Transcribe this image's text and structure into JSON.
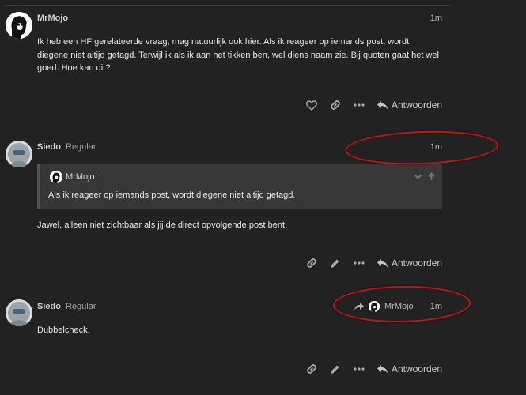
{
  "posts": [
    {
      "username": "MrMojo",
      "user_title": "",
      "time": "1m",
      "text": "Ik heb een HF gerelateerde vraag, mag natuurlijk ook hier. Als ik reageer op iemands post, wordt diegene niet altijd getagd. Terwijl ik als ik aan het tikken ben, wel diens naam zie. Bij quoten gaat het wel goed. Hoe kan dit?",
      "reply_label": "Antwoorden"
    },
    {
      "username": "Siedo",
      "user_title": "Regular",
      "time": "1m",
      "quote": {
        "username": "MrMojo:",
        "text": "Als ik reageer op iemands post, wordt diegene niet altijd getagd."
      },
      "text": "Jawel, alleen niet zichtbaar als jij de direct opvolgende post bent.",
      "reply_label": "Antwoorden"
    },
    {
      "username": "Siedo",
      "user_title": "Regular",
      "time": "1m",
      "reply_to_user": "MrMojo",
      "text": "Dubbelcheck.",
      "reply_label": "Antwoorden"
    }
  ],
  "colors": {
    "background": "#222222",
    "annotation_red": "#b8161a",
    "quote_background": "#383838"
  },
  "icons": [
    "heart-icon",
    "link-icon",
    "ellipsis-icon",
    "reply-icon",
    "pencil-icon",
    "chevron-down-icon",
    "arrow-up-icon",
    "reply-arrow-icon"
  ]
}
